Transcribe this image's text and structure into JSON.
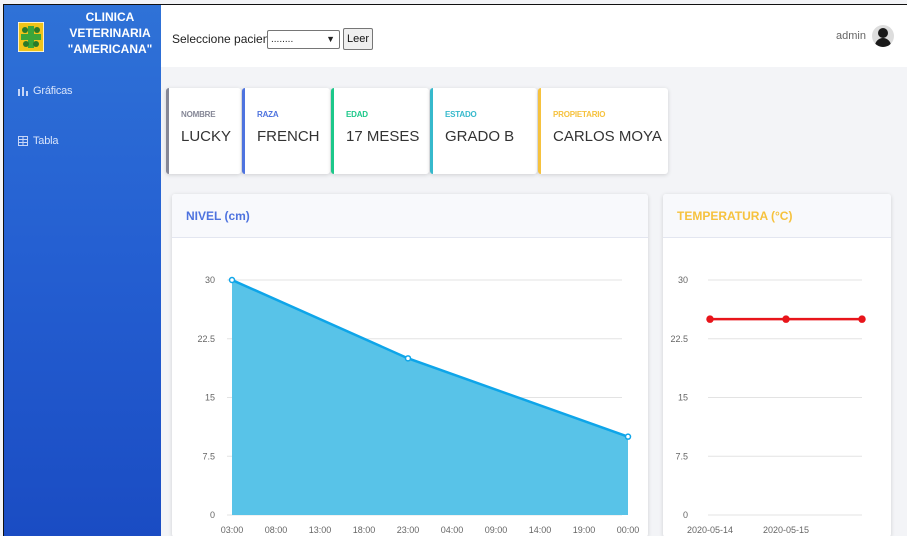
{
  "brand": {
    "lines": [
      "CLINICA",
      "VETERINARIA",
      "\"AMERICANA\""
    ]
  },
  "sidebar": {
    "items": [
      {
        "label": "Gráficas",
        "icon": "bar-chart-icon"
      },
      {
        "label": "Tabla",
        "icon": "table-icon"
      }
    ]
  },
  "topbar": {
    "select_label": "Seleccione paciente",
    "select_value": "........",
    "read_button": "Leer",
    "username": "admin"
  },
  "patient": [
    {
      "label": "NOMBRE",
      "value": "LUCKY",
      "color": "#858796"
    },
    {
      "label": "RAZA",
      "value": "FRENCH",
      "color": "#4e73df"
    },
    {
      "label": "EDAD",
      "value": "17 MESES",
      "color": "#1cc88a"
    },
    {
      "label": "ESTADO",
      "value": "GRADO B",
      "color": "#36b9cc"
    },
    {
      "label": "PROPIETARIO",
      "value": "CARLOS MOYA",
      "color": "#f6c23e"
    }
  ],
  "chart_data": [
    {
      "type": "area",
      "title": "NIVEL (cm)",
      "title_color": "#4e73df",
      "y_ticks": [
        "30",
        "22.5",
        "15",
        "7.5",
        "0"
      ],
      "x": [
        "03:00",
        "08:00",
        "13:00",
        "18:00",
        "23:00",
        "04:00",
        "09:00",
        "14:00",
        "19:00",
        "00:00"
      ],
      "points": [
        {
          "x": "03:00",
          "y": 30
        },
        {
          "x": "23:00",
          "y": 20
        },
        {
          "x": "00:00",
          "y": 10
        }
      ],
      "ylim": [
        0,
        30
      ],
      "line_color": "#0ea5e9",
      "fill_color": "#58c3e8"
    },
    {
      "type": "line",
      "title": "TEMPERATURA (°C)",
      "title_color": "#f6c23e",
      "y_ticks": [
        "30",
        "22.5",
        "15",
        "7.5",
        "0"
      ],
      "x": [
        "2020-05-14",
        "2020-05-15"
      ],
      "points": [
        {
          "x": "2020-05-14",
          "y": 25
        },
        {
          "x": "2020-05-15",
          "y": 25
        },
        {
          "x": "",
          "y": 25
        }
      ],
      "ylim": [
        0,
        30
      ],
      "line_color": "#e8151b"
    }
  ]
}
